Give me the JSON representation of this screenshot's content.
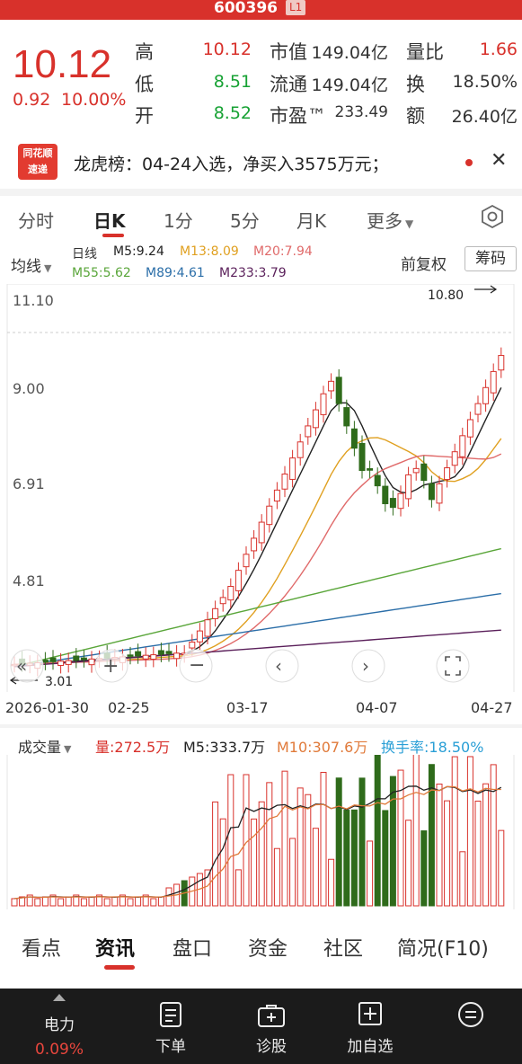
{
  "header": {
    "code": "600396",
    "level_badge": "L1"
  },
  "quote": {
    "price": "10.12",
    "change": "0.92",
    "change_pct": "10.00%",
    "rows": [
      {
        "l1": "高",
        "v1": "10.12",
        "l2": "市值",
        "v2": "149.04亿",
        "l3": "量比",
        "v3": "1.66"
      },
      {
        "l1": "低",
        "v1": "8.51",
        "l2": "流通",
        "v2": "149.04亿",
        "l3": "换",
        "v3": "18.50%"
      },
      {
        "l1": "开",
        "v1": "8.52",
        "l2": "市盈™",
        "v2": "233.49",
        "l3": "额",
        "v3": "26.40亿"
      }
    ]
  },
  "news": {
    "logo_top": "同花顺",
    "logo_bottom": "速递",
    "text": "龙虎榜：04-24入选，净买入3575万元；"
  },
  "tabs": [
    "分时",
    "日K",
    "1分",
    "5分",
    "月K",
    "更多"
  ],
  "active_tab": "日K",
  "legend": {
    "indicator_select": "均线",
    "row1": [
      "日线",
      "M5:9.24",
      "M13:8.09",
      "M20:7.94"
    ],
    "row2": [
      "M55:5.62",
      "M89:4.61",
      "M233:3.79"
    ],
    "adjust": "前复权",
    "chip_button": "筹码"
  },
  "colors": {
    "up": "#d8312b",
    "down": "#2f6b1b",
    "m5": "#222222",
    "m13": "#e0a020",
    "m20": "#e06a6a",
    "m55": "#5aa63a",
    "m89": "#2b6ea8",
    "m233": "#5a1f5a"
  },
  "axis": {
    "y_labels": [
      "11.10",
      "9.00",
      "6.91",
      "4.81"
    ],
    "high_marker": "10.80",
    "low_marker": "3.01",
    "dates": [
      "2026-01-30",
      "02-25",
      "03-17",
      "04-07",
      "04-27"
    ]
  },
  "volume_legend": {
    "select": "成交量",
    "vol": "量:272.5万",
    "m5": "M5:333.7万",
    "m10": "M10:307.6万",
    "turnover": "换手率:18.50%"
  },
  "bottom_tabs": [
    "看点",
    "资讯",
    "盘口",
    "资金",
    "社区",
    "简况(F10)"
  ],
  "active_bottom_tab": "资讯",
  "bottom_bar": {
    "sector": "电力",
    "sector_pct": "0.09%",
    "items": [
      "下单",
      "诊股",
      "加自选"
    ]
  }
}
